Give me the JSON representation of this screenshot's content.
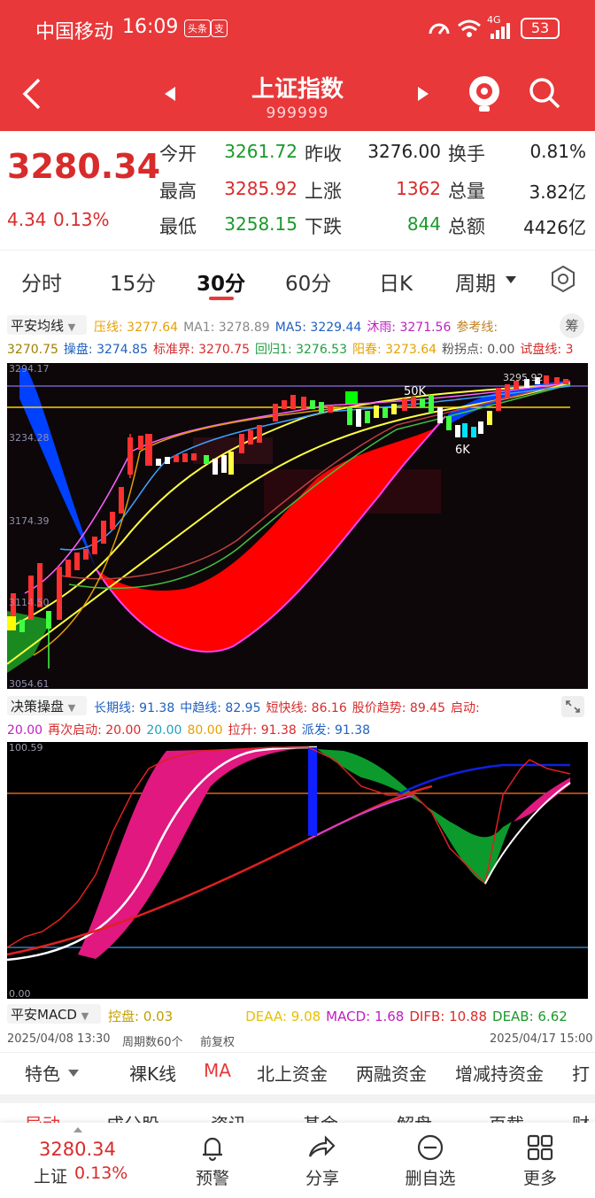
{
  "status": {
    "carrier": "中国移动",
    "time": "16:09",
    "app_badges": [
      "头条",
      "支"
    ],
    "network": "4G",
    "battery": "53"
  },
  "header": {
    "title": "上证指数",
    "code": "999999"
  },
  "quote": {
    "price": "3280.34",
    "change": "4.34",
    "change_pct": "0.13%",
    "stats": [
      {
        "label": "今开",
        "value": "3261.72",
        "color": "#1a9a2a"
      },
      {
        "label": "昨收",
        "value": "3276.00",
        "color": "#222222"
      },
      {
        "label": "换手",
        "value": "0.81%",
        "color": "#222222"
      },
      {
        "label": "最高",
        "value": "3285.92",
        "color": "#d82b2b"
      },
      {
        "label": "上涨",
        "value": "1362",
        "color": "#d82b2b"
      },
      {
        "label": "总量",
        "value": "3.82亿",
        "color": "#222222"
      },
      {
        "label": "最低",
        "value": "3258.15",
        "color": "#1a9a2a"
      },
      {
        "label": "下跌",
        "value": "844",
        "color": "#1a9a2a"
      },
      {
        "label": "总额",
        "value": "4426亿",
        "color": "#222222"
      }
    ]
  },
  "period_tabs": [
    "分时",
    "15分",
    "30分",
    "60分",
    "日K",
    "周期"
  ],
  "active_tab": "30分",
  "indicator1": {
    "name": "平安均线",
    "line1": [
      {
        "t": "压线: 3277.64",
        "c": "#e8a000"
      },
      {
        "t": "MA1: 3278.89",
        "c": "#888888"
      },
      {
        "t": "MA5: 3229.44",
        "c": "#2060c0"
      },
      {
        "t": "沐雨: 3271.56",
        "c": "#c020c0"
      },
      {
        "t": "参考线:",
        "c": "#c08020"
      }
    ],
    "side": "筹",
    "line2": [
      {
        "t": "3270.75",
        "c": "#a08000"
      },
      {
        "t": "操盘: 3274.85",
        "c": "#2060c0"
      },
      {
        "t": "标准界: 3270.75",
        "c": "#d82b2b"
      },
      {
        "t": "回归1: 3276.53",
        "c": "#20a040"
      },
      {
        "t": "阳春: 3273.64",
        "c": "#e8a000"
      },
      {
        "t": "粉拐点: 0.00",
        "c": "#555555"
      },
      {
        "t": "试盘线: 3",
        "c": "#d82b2b"
      }
    ]
  },
  "main_chart_labels": {
    "y_top": "3294.17",
    "y_mid": "3234.28",
    "y_low": "3174.39",
    "y_low2": "3114.50",
    "y_bottom": "3054.61",
    "label_50k": "50K",
    "label_6k": "6K",
    "label_price": "3295.92"
  },
  "indicator2": {
    "name": "决策操盘",
    "line1": [
      {
        "t": "长期线: 91.38",
        "c": "#2060c0"
      },
      {
        "t": "中趋线: 82.95",
        "c": "#2060c0"
      },
      {
        "t": "短快线: 86.16",
        "c": "#d82b2b"
      },
      {
        "t": "股价趋势: 89.45",
        "c": "#d82b2b"
      },
      {
        "t": "启动:",
        "c": "#d82b2b"
      }
    ],
    "line2": [
      {
        "t": "20.00",
        "c": "#c020c0"
      },
      {
        "t": "再次启动: 20.00",
        "c": "#d82b2b"
      },
      {
        "t": "20.00",
        "c": "#20a0c0"
      },
      {
        "t": "80.00",
        "c": "#e8a000"
      },
      {
        "t": "拉升: 91.38",
        "c": "#d82b2b"
      },
      {
        "t": "派发: 91.38",
        "c": "#2060c0"
      }
    ],
    "y_top": "100.59",
    "y_bottom": "0.00"
  },
  "indicator3": {
    "name": "平安MACD",
    "items": [
      {
        "t": "控盘: 0.03",
        "c": "#c0a000"
      },
      {
        "t": "DEAA: 9.08",
        "c": "#e8c000"
      },
      {
        "t": "MACD: 1.68",
        "c": "#c020c0"
      },
      {
        "t": "DIFB: 10.88",
        "c": "#d82b2b"
      },
      {
        "t": "DEAB: 6.62",
        "c": "#1a9a2a"
      }
    ]
  },
  "footer_info": {
    "start": "2025/04/08 13:30",
    "periods": "周期数60个",
    "adjust": "前复权",
    "end": "2025/04/17 15:00"
  },
  "feature_nav": [
    "特色",
    "裸K线",
    "MA",
    "北上资金",
    "两融资金",
    "增减持资金",
    "打"
  ],
  "sub_nav_peek": [
    "异动",
    "成分股",
    "资讯",
    "基金",
    "解盘",
    "页截",
    "财"
  ],
  "bottom_bar": {
    "price": "3280.34",
    "name": "上证",
    "pct": "0.13%",
    "actions": [
      "预警",
      "分享",
      "删自选",
      "更多"
    ]
  }
}
